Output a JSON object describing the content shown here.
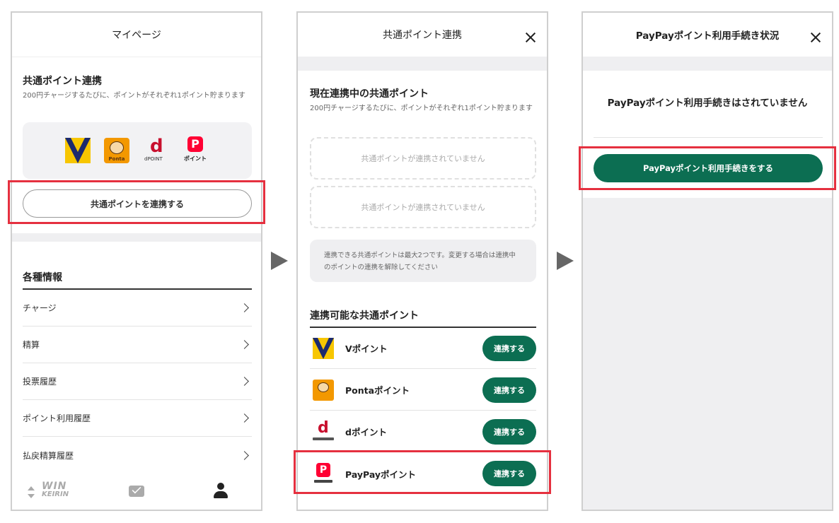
{
  "panel1": {
    "title": "マイページ",
    "common_points": {
      "heading": "共通ポイント連携",
      "description": "200円チャージするたびに、ポイントがそれぞれ1ポイント貯まります",
      "logos": {
        "ponta_text": "Ponta",
        "dpoint_text": "POINT",
        "paypay_text": "ポイント"
      },
      "link_button": "共通ポイントを連携する"
    },
    "info": {
      "heading": "各種情報",
      "items": [
        {
          "label": "チャージ"
        },
        {
          "label": "精算"
        },
        {
          "label": "投票履歴"
        },
        {
          "label": "ポイント利用履歴"
        },
        {
          "label": "払戻精算履歴"
        }
      ]
    },
    "tabbar": {
      "win_line1": "WIN",
      "win_line2": "KEIRIN"
    }
  },
  "panel2": {
    "title": "共通ポイント連携",
    "current": {
      "heading": "現在連携中の共通ポイント",
      "description": "200円チャージするたびに、ポイントがそれぞれ1ポイント貯まります",
      "empty_slots": [
        "共通ポイントが連携されていません",
        "共通ポイントが連携されていません"
      ],
      "note": "連携できる共通ポイントは最大2つです。変更する場合は連携中のポイントの連携を解除してください"
    },
    "available": {
      "heading": "連携可能な共通ポイント",
      "items": [
        {
          "name": "Vポイント",
          "button": "連携する"
        },
        {
          "name": "Pontaポイント",
          "button": "連携する"
        },
        {
          "name": "dポイント",
          "button": "連携する"
        },
        {
          "name": "PayPayポイント",
          "button": "連携する"
        }
      ]
    }
  },
  "panel3": {
    "title": "PayPayポイント利用手続き状況",
    "status": "PayPayポイント利用手続きはされていません",
    "button": "PayPayポイント利用手続きをする"
  },
  "colors": {
    "accent_green": "#0c6e52",
    "highlight_red": "#e5303f",
    "v_yellow": "#f7c600",
    "v_navy": "#1b2a6e",
    "ponta_orange": "#f39800",
    "dpoint_red": "#c8102e",
    "paypay_red": "#ff0033"
  }
}
